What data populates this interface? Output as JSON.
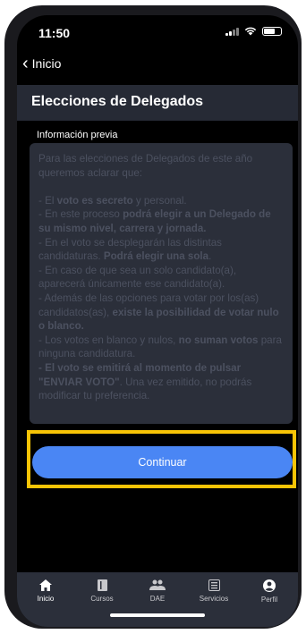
{
  "status_bar": {
    "time": "11:50"
  },
  "nav": {
    "back_label": "Inicio"
  },
  "header": {
    "title": "Elecciones de Delegados"
  },
  "section": {
    "label": "Información previa"
  },
  "info_text": {
    "p1": "Para las elecciones de Delegados de este año queremos aclarar que:",
    "l1_a": "- El ",
    "l1_b": "voto es secreto",
    "l1_c": " y personal.",
    "l2_a": "- En este proceso ",
    "l2_b": "podrá elegir a un Delegado de su mismo nivel, carrera y jornada.",
    "l3_a": "- En el voto se desplegarán las distintas candidaturas. ",
    "l3_b": "Podrá elegir una sola",
    "l3_c": ".",
    "l4": "- En caso de que sea un solo candidato(a), aparecerá únicamente ese candidato(a).",
    "l5_a": "- Además de las opciones para votar por los(as) candidatos(as), ",
    "l5_b": "existe la posibilidad de votar nulo o blanco.",
    "l6_a": "- Los votos en blanco y nulos, ",
    "l6_b": "no suman votos",
    "l6_c": " para ninguna candidatura.",
    "l7_a": "- El voto se emitirá al momento de pulsar \"ENVIAR VOTO\"",
    "l7_b": ". Una vez emitido, no podrás modificar tu preferencia."
  },
  "button": {
    "continue_label": "Continuar"
  },
  "colors": {
    "accent": "#4a86f4",
    "highlight": "#f7c406",
    "panel": "#2b2f3a"
  },
  "tabbar": {
    "items": [
      {
        "label": "Inicio",
        "icon": "home-icon"
      },
      {
        "label": "Cursos",
        "icon": "book-icon"
      },
      {
        "label": "DAE",
        "icon": "people-icon"
      },
      {
        "label": "Servicios",
        "icon": "list-icon"
      },
      {
        "label": "Perfil",
        "icon": "profile-icon"
      }
    ]
  }
}
